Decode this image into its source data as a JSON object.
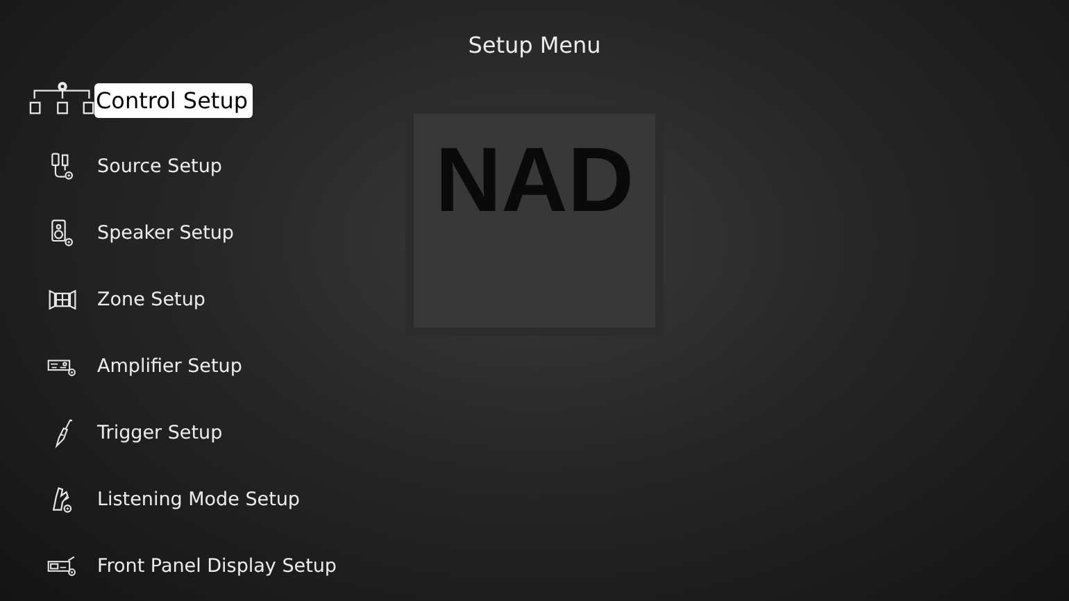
{
  "screen": {
    "title": "Setup Menu",
    "background_logo": "NAD"
  },
  "menu": [
    {
      "label": "Control Setup",
      "selected": true
    },
    {
      "label": "Source Setup",
      "selected": false
    },
    {
      "label": "Speaker Setup",
      "selected": false
    },
    {
      "label": "Zone Setup",
      "selected": false
    },
    {
      "label": "Amplifier Setup",
      "selected": false
    },
    {
      "label": "Trigger Setup",
      "selected": false
    },
    {
      "label": "Listening Mode Setup",
      "selected": false
    },
    {
      "label": "Front Panel Display Setup",
      "selected": false
    }
  ]
}
